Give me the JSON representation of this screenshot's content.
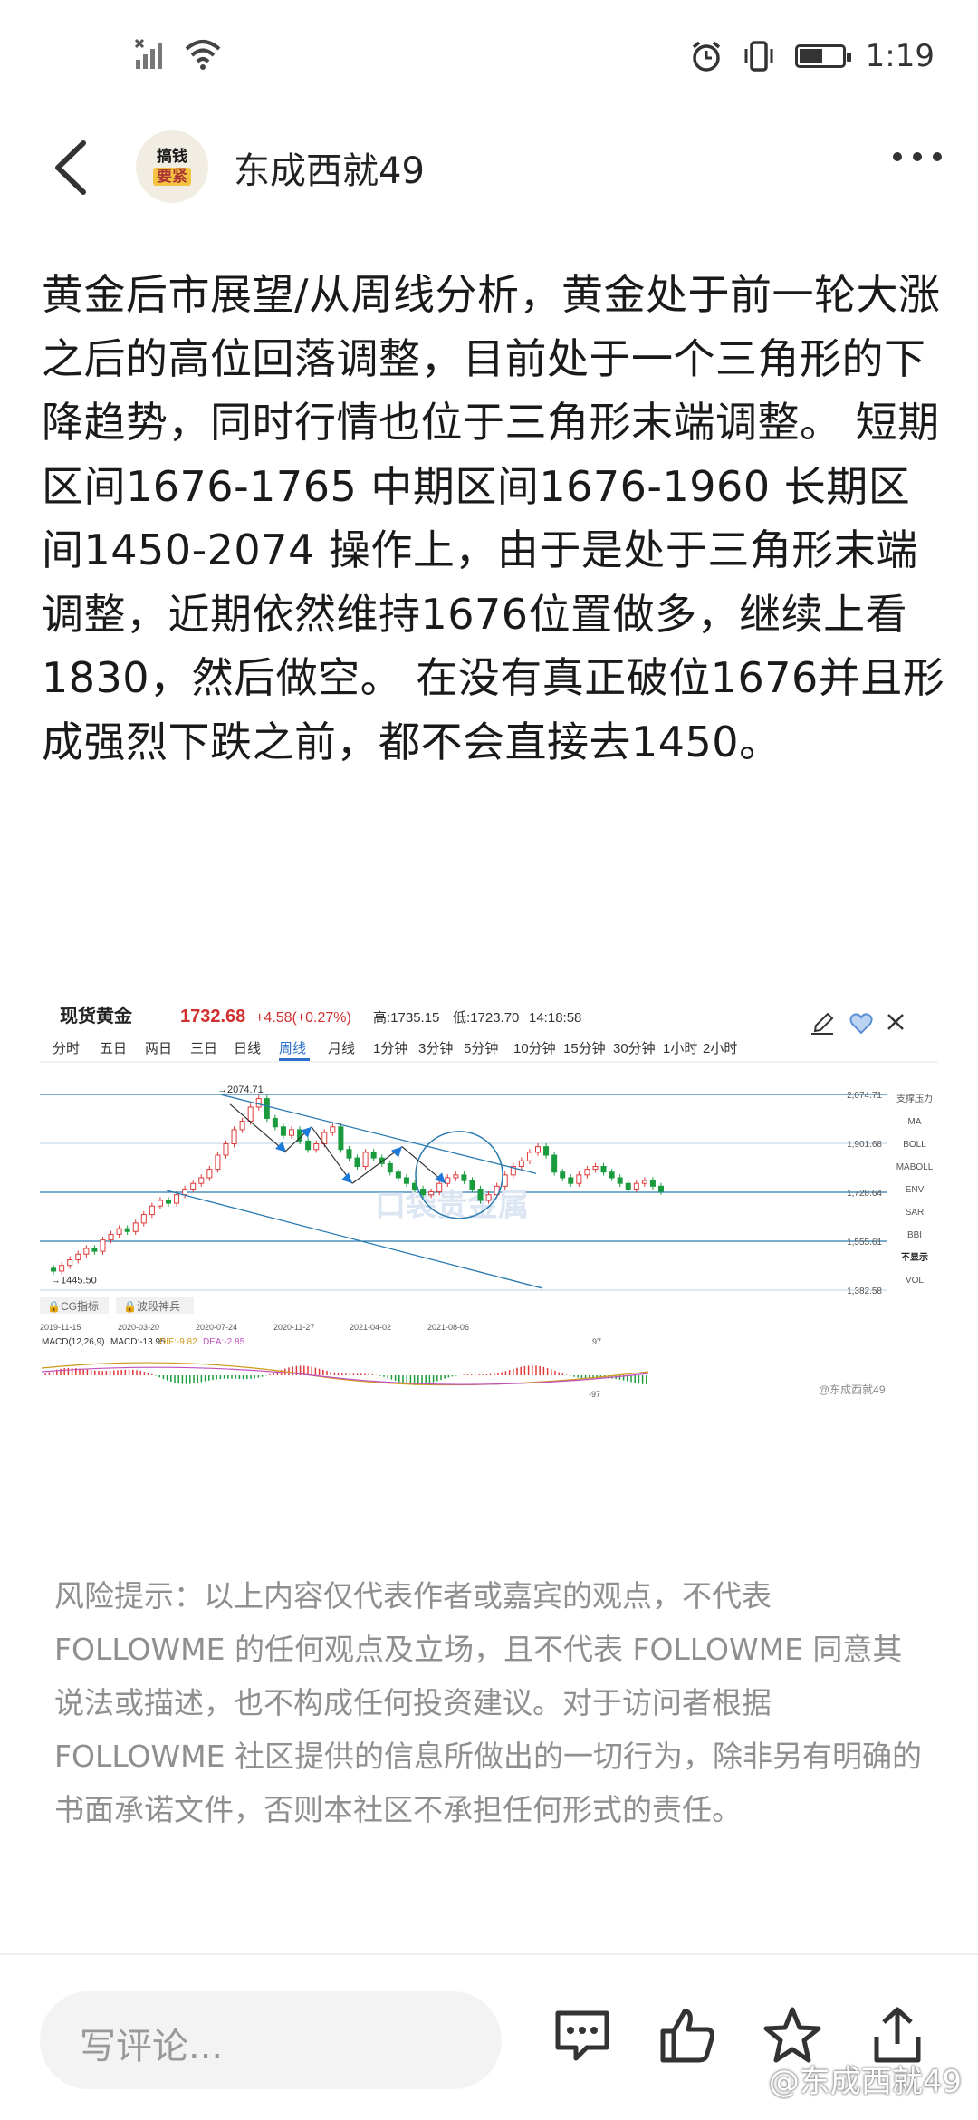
{
  "status_bar": {
    "time": "1:19",
    "battery_level": 0.55
  },
  "header": {
    "username": "东成西就49",
    "avatar_line1": "搞钱",
    "avatar_line2": "要紧"
  },
  "post": {
    "text": "黄金后市展望/从周线分析，黄金处于前一轮大涨之后的高位回落调整，目前处于一个三角形的下降趋势，同时行情也位于三角形末端调整。 短期区间1676-1765 中期区间1676-1960 长期区间1450-2074 操作上，由于是处于三角形末端调整，近期依然维持1676位置做多，继续上看1830，然后做空。 在没有真正破位1676并且形成强烈下跌之前，都不会直接去1450。"
  },
  "chart": {
    "title": "现货黄金",
    "price": "1732.68",
    "change": "+4.58(+0.27%)",
    "high": "高:1735.15",
    "low": "低:1723.70",
    "time": "14:18:58",
    "tabs": [
      "分时",
      "五日",
      "两日",
      "三日",
      "日线",
      "周线",
      "月线",
      "1分钟",
      "3分钟",
      "5分钟",
      "10分钟",
      "15分钟",
      "30分钟",
      "1小时",
      "2小时"
    ],
    "active_tab": "周线",
    "price_levels": [
      "2,074.71",
      "1,901.68",
      "1,728.64",
      "1,555.61",
      "1,382.58"
    ],
    "high_marker": "2074.71",
    "low_marker": "1445.50",
    "dates": [
      "2019-11-15",
      "2020-03-20",
      "2020-07-24",
      "2020-11-27",
      "2021-04-02",
      "2021-08-06"
    ],
    "side_items": [
      "支撑压力",
      "MA",
      "BOLL",
      "MABOLL",
      "ENV",
      "SAR",
      "BBI",
      "不显示",
      "VOL"
    ],
    "tag1": "CG指标",
    "tag2": "波段神兵",
    "macd_label": "MACD(12,26,9)",
    "macd_value": "MACD:-13.95",
    "dif_value": "DIF:-9.82",
    "dea_value": "DEA:-2.85",
    "macd_top": "97",
    "macd_bottom": "-97",
    "watermark_text": "口袋贵金属",
    "weibo_mark": "@东成西就49",
    "colors": {
      "up": "#e03a3a",
      "down": "#1a9c3e",
      "line": "#2a7ab0",
      "arrow": "#1e7ad8"
    }
  },
  "disclaimer": "风险提示：以上内容仅代表作者或嘉宾的观点，不代表 FOLLOWME 的任何观点及立场，且不代表 FOLLOWME 同意其说法或描述，也不构成任何投资建议。对于访问者根据 FOLLOWME 社区提供的信息所做出的一切行为，除非另有明确的书面承诺文件，否则本社区不承担任何形式的责任。",
  "bottom_bar": {
    "comment_placeholder": "写评论...",
    "watermark": "@东成西就49"
  }
}
